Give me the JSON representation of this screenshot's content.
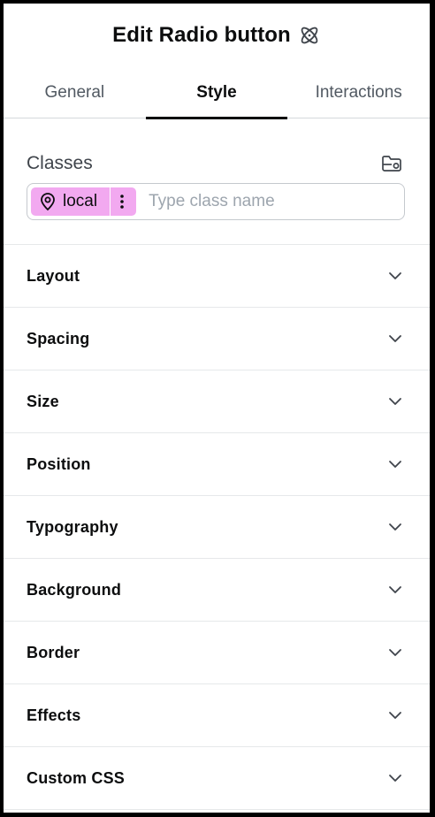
{
  "header": {
    "title": "Edit Radio button",
    "icon": "atom-icon"
  },
  "tabs": [
    {
      "label": "General",
      "active": false
    },
    {
      "label": "Style",
      "active": true
    },
    {
      "label": "Interactions",
      "active": false
    }
  ],
  "classes": {
    "label": "Classes",
    "manage_icon": "folder-settings-icon",
    "chip": {
      "label": "local",
      "color": "#f2a9f0",
      "icon": "map-pin-icon",
      "menu_icon": "more-vertical-icon"
    },
    "input_placeholder": "Type class name",
    "input_value": ""
  },
  "sections": [
    {
      "label": "Layout"
    },
    {
      "label": "Spacing"
    },
    {
      "label": "Size"
    },
    {
      "label": "Position"
    },
    {
      "label": "Typography"
    },
    {
      "label": "Background"
    },
    {
      "label": "Border"
    },
    {
      "label": "Effects"
    },
    {
      "label": "Custom CSS"
    }
  ]
}
